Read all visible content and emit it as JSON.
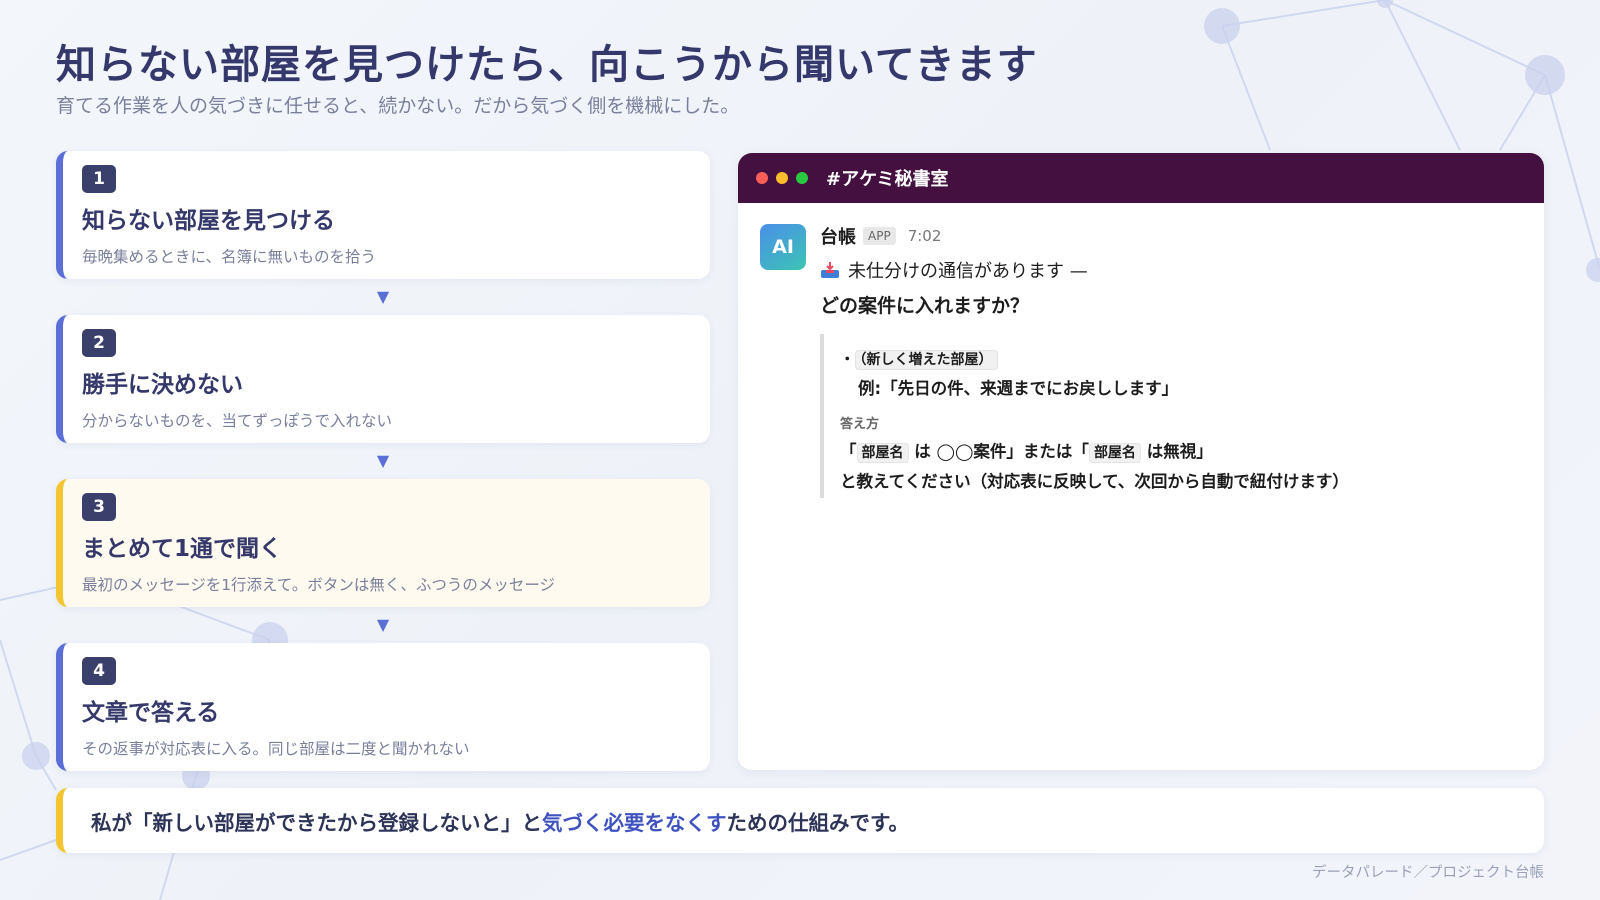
{
  "page": {
    "title": "知らない部屋を見つけたら、向こうから聞いてきます",
    "subtitle": "育てる作業を人の気づきに任せると、続かない。だから気づく側を機械にした。"
  },
  "steps": [
    {
      "num": "1",
      "title": "知らない部屋を見つける",
      "desc": "毎晩集めるときに、名簿に無いものを拾う"
    },
    {
      "num": "2",
      "title": "勝手に決めない",
      "desc": "分からないものを、当てずっぽうで入れない"
    },
    {
      "num": "3",
      "title": "まとめて1通で聞く",
      "desc": "最初のメッセージを1行添えて。ボタンは無く、ふつうのメッセージ"
    },
    {
      "num": "4",
      "title": "文章で答える",
      "desc": "その返事が対応表に入る。同じ部屋は二度と聞かれない"
    }
  ],
  "arrow_glyph": "▼",
  "chat": {
    "channel": "#アケミ秘書室",
    "avatar_text": "AI",
    "sender": "台帳",
    "badge": "APP",
    "time": "7:02",
    "inbox_icon": "inbox-tray-icon",
    "line1": "未仕分けの通信があります —",
    "line2": "どの案件に入れますか？",
    "bullet": "・",
    "new_room": "（新しく増えた部屋）",
    "example": "例:「先日の件、来週までにお戻しします」",
    "answer_label": "答え方",
    "room_name": "部屋名",
    "answer_part1": "「",
    "answer_part2": "は ◯◯案件」または「",
    "answer_part3": "は無視」",
    "answer_line2": "と教えてください（対応表に反映して、次回から自動で紐付けます）"
  },
  "footer": {
    "text_before": "私が「新しい部屋ができたから登録しないと」と",
    "text_accent": "気づく必要をなくす",
    "text_after": "ための仕組みです。"
  },
  "credit": "データパレード／プロジェクト台帳",
  "colors": {
    "accent_blue": "#5b6fd6",
    "accent_yellow": "#f2c531",
    "header_purple": "#43103f",
    "text_navy": "#35386a"
  }
}
